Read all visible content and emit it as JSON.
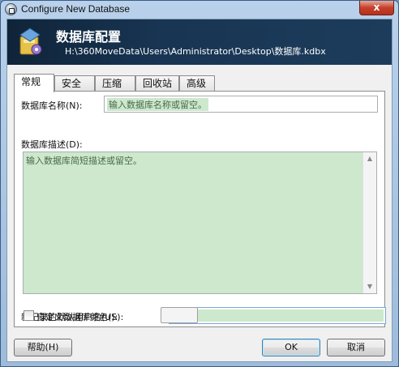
{
  "window": {
    "title": "Configure New Database",
    "close_symbol": "x"
  },
  "banner": {
    "title": "数据库配置",
    "path": "H:\\360MoveData\\Users\\Administrator\\Desktop\\数据库.kdbx",
    "icon": "database-settings-icon"
  },
  "tabs": [
    {
      "label": "常规",
      "active": true
    },
    {
      "label": "安全",
      "active": false
    },
    {
      "label": "压缩",
      "active": false
    },
    {
      "label": "回收站",
      "active": false
    },
    {
      "label": "高级",
      "active": false
    }
  ],
  "general": {
    "name_label": "数据库名称(N):",
    "name_placeholder": "输入数据库名称或留空。",
    "desc_label": "数据库描述(D):",
    "desc_placeholder": "输入数据库简短描述或留空。",
    "default_user_label": "新记录的默认用户名(U):",
    "default_user_value": "",
    "custom_color_label": "自定义数据库颜色(S):",
    "custom_color_checked": false
  },
  "buttons": {
    "help": "帮助(H)",
    "ok": "OK",
    "cancel": "取消"
  },
  "colors": {
    "field_highlight": "#cde8cd",
    "banner_bg": "#183553"
  }
}
